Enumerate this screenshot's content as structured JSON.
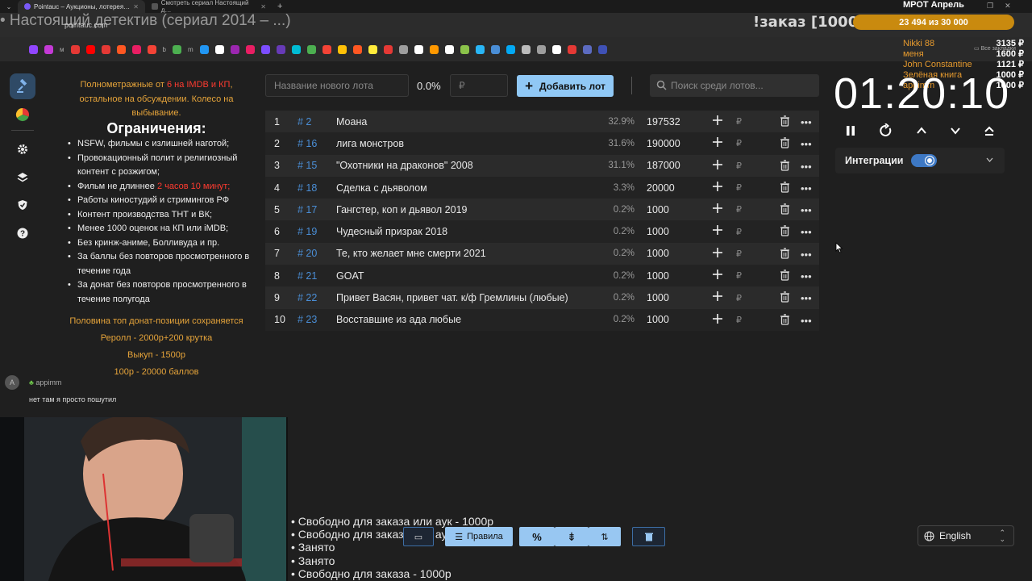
{
  "browser": {
    "tabs": [
      {
        "title": "Pointauc – Аукционы, лотерея…",
        "active": true
      },
      {
        "title": "Смотреть сериал Настоящий д…",
        "active": false
      }
    ],
    "url": "pointauc.com",
    "bookmark_labels": [
      "м",
      "b",
      "m"
    ],
    "bookmarks_folder": "Все закладки"
  },
  "overlay": {
    "title": "• Настоящий детектив (сериал 2014 – ...)",
    "order_title": "!заказ [1000р]",
    "goal_title": "МРОТ Апрель",
    "goal_progress": "23 494 из 30 000",
    "donors": [
      {
        "name": "Nikki 88",
        "value": "3135 ₽"
      },
      {
        "name": "меня",
        "value": "1600 ₽"
      },
      {
        "name": "John Constantine",
        "value": "1121 ₽"
      },
      {
        "name": "Зелёная книга",
        "value": "1000 ₽"
      },
      {
        "name": "appimm",
        "value": "1000 ₽"
      }
    ]
  },
  "rules": {
    "intro_a": "Полнометражные от ",
    "intro_red": "6 на IMDB и КП",
    "intro_b": ", остальное на обсуждении. Колесо на выбывание.",
    "heading": "Ограничения:",
    "items": [
      "NSFW, фильмы с излишней наготой;",
      "Провокационный полит и религиозный контент с розжигом;",
      "Фильм не длиннее ",
      "Работы киностудий и стримингов РФ",
      "Контент производства ТНТ и ВК;",
      "Менее 1000 оценок на КП или iMDB;",
      "Без кринж-аниме, Болливуда и пр.",
      "За баллы без повторов просмотренного в течение года",
      "За донат без повторов просмотренного в течение полугода"
    ],
    "item3_red": "2 часов 10 минут;",
    "footer": [
      "Половина топ донат-позиции сохраняется",
      "Реролл - 2000р+200 крутка",
      "Выкуп - 1500р",
      "100р - 20000 баллов"
    ]
  },
  "chat": {
    "avatar": "A",
    "username": "appimm",
    "message": "нет там я просто пошутил"
  },
  "lot_form": {
    "name_placeholder": "Название нового лота",
    "percent": "0.0%",
    "amount_placeholder": "₽",
    "add_label": "Добавить лот",
    "search_placeholder": "Поиск среди лотов..."
  },
  "lots": [
    {
      "idx": "1",
      "id": "# 2",
      "name": "Моана",
      "pct": "32.9%",
      "amount": "197532"
    },
    {
      "idx": "2",
      "id": "# 16",
      "name": "лига монстров",
      "pct": "31.6%",
      "amount": "190000"
    },
    {
      "idx": "3",
      "id": "# 15",
      "name": "\"Охотники на драконов\" 2008",
      "pct": "31.1%",
      "amount": "187000"
    },
    {
      "idx": "4",
      "id": "# 18",
      "name": "Сделка с дьяволом",
      "pct": "3.3%",
      "amount": "20000"
    },
    {
      "idx": "5",
      "id": "# 17",
      "name": "Гангстер, коп и дьявол 2019",
      "pct": "0.2%",
      "amount": "1000"
    },
    {
      "idx": "6",
      "id": "# 19",
      "name": "Чудесный призрак 2018",
      "pct": "0.2%",
      "amount": "1000"
    },
    {
      "idx": "7",
      "id": "# 20",
      "name": "Те, кто желает мне смерти 2021",
      "pct": "0.2%",
      "amount": "1000"
    },
    {
      "idx": "8",
      "id": "# 21",
      "name": "GOAT",
      "pct": "0.2%",
      "amount": "1000"
    },
    {
      "idx": "9",
      "id": "# 22",
      "name": "Привет Васян, привет чат. к/ф Гремлины (любые)",
      "pct": "0.2%",
      "amount": "1000"
    },
    {
      "idx": "10",
      "id": "# 23",
      "name": "Восставшие из ада любые",
      "pct": "0.2%",
      "amount": "1000"
    }
  ],
  "lot_currency": "₽",
  "timer": {
    "value": "01:20:10"
  },
  "integrations": {
    "label": "Интеграции",
    "enabled": true
  },
  "status_lines": [
    "Свободно для заказа или аук - 1000р",
    "Свободно для заказа или аук - 1000р",
    "Занято",
    "Занято",
    "Свободно для заказа - 1000р"
  ],
  "bottom_bar": {
    "rules_label": "Правила",
    "percent_label": "%"
  },
  "language": {
    "selected": "English"
  },
  "colors": {
    "accent": "#90c8f5",
    "lot_id": "#4a8ed6",
    "highlight": "#e6a43a",
    "danger": "#ff3b30"
  }
}
